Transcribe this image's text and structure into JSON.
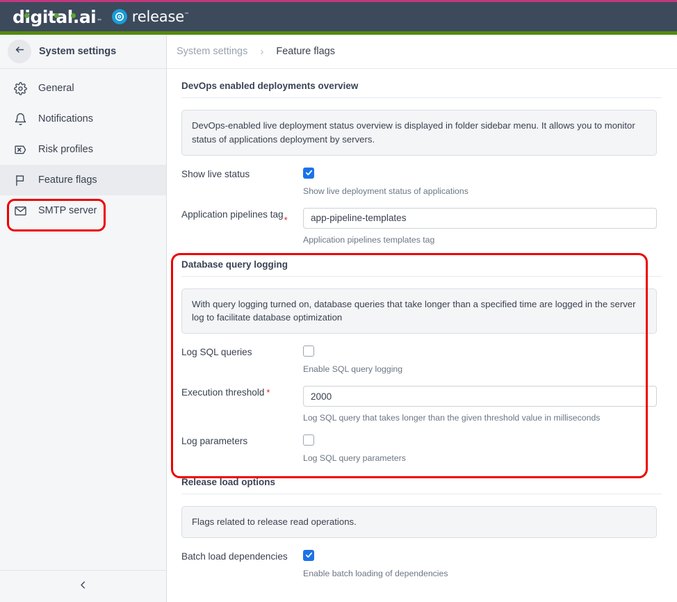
{
  "brand": {
    "logo_text": "digital.ai",
    "logo_tm": "™",
    "product_name": "release",
    "product_tm": "™",
    "header_bg": "#3c4a5c",
    "accent_green": "#548a0f",
    "accent_magenta": "#c2387e",
    "release_badge_color": "#1b9bd8"
  },
  "sidebar": {
    "back_icon": "arrow-left-icon",
    "title": "System settings",
    "items": [
      {
        "label": "General",
        "icon": "gear-icon",
        "active": false
      },
      {
        "label": "Notifications",
        "icon": "bell-icon",
        "active": false
      },
      {
        "label": "Risk profiles",
        "icon": "risk-profile-icon",
        "active": false
      },
      {
        "label": "Feature flags",
        "icon": "flag-icon",
        "active": true
      },
      {
        "label": "SMTP server",
        "icon": "envelope-icon",
        "active": false
      }
    ],
    "collapse_icon": "chevron-left-icon"
  },
  "breadcrumb": {
    "parent": "System settings",
    "separator": "›",
    "current": "Feature flags"
  },
  "sections": [
    {
      "title": "DevOps enabled deployments overview",
      "callout": "DevOps-enabled live deployment status overview is displayed in folder sidebar menu. It allows you to monitor status of applications deployment by servers.",
      "fields": [
        {
          "label": "Show live status",
          "type": "checkbox",
          "checked": true,
          "required": false,
          "hint": "Show live deployment status of applications"
        },
        {
          "label": "Application pipelines tag",
          "type": "text",
          "value": "app-pipeline-templates",
          "required": true,
          "hint": "Application pipelines templates tag"
        }
      ]
    },
    {
      "title": "Database query logging",
      "callout": "With query logging turned on, database queries that take longer than a specified time are logged in the server log to facilitate database optimization",
      "fields": [
        {
          "label": "Log SQL queries",
          "type": "checkbox",
          "checked": false,
          "required": false,
          "hint": "Enable SQL query logging"
        },
        {
          "label": "Execution threshold",
          "type": "text",
          "value": "2000",
          "required": true,
          "hint": "Log SQL query that takes longer than the given threshold value in milliseconds"
        },
        {
          "label": "Log parameters",
          "type": "checkbox",
          "checked": false,
          "required": false,
          "hint": "Log SQL query parameters"
        }
      ]
    },
    {
      "title": "Release load options",
      "callout": "Flags related to release read operations.",
      "fields": [
        {
          "label": "Batch load dependencies",
          "type": "checkbox",
          "checked": true,
          "required": false,
          "hint": "Enable batch loading of dependencies"
        }
      ]
    }
  ],
  "annotations": {
    "highlight_color": "#ee0000",
    "boxes": [
      {
        "name": "feature-flags-nav-highlight"
      },
      {
        "name": "database-query-logging-highlight"
      }
    ]
  },
  "required_marker": "*"
}
